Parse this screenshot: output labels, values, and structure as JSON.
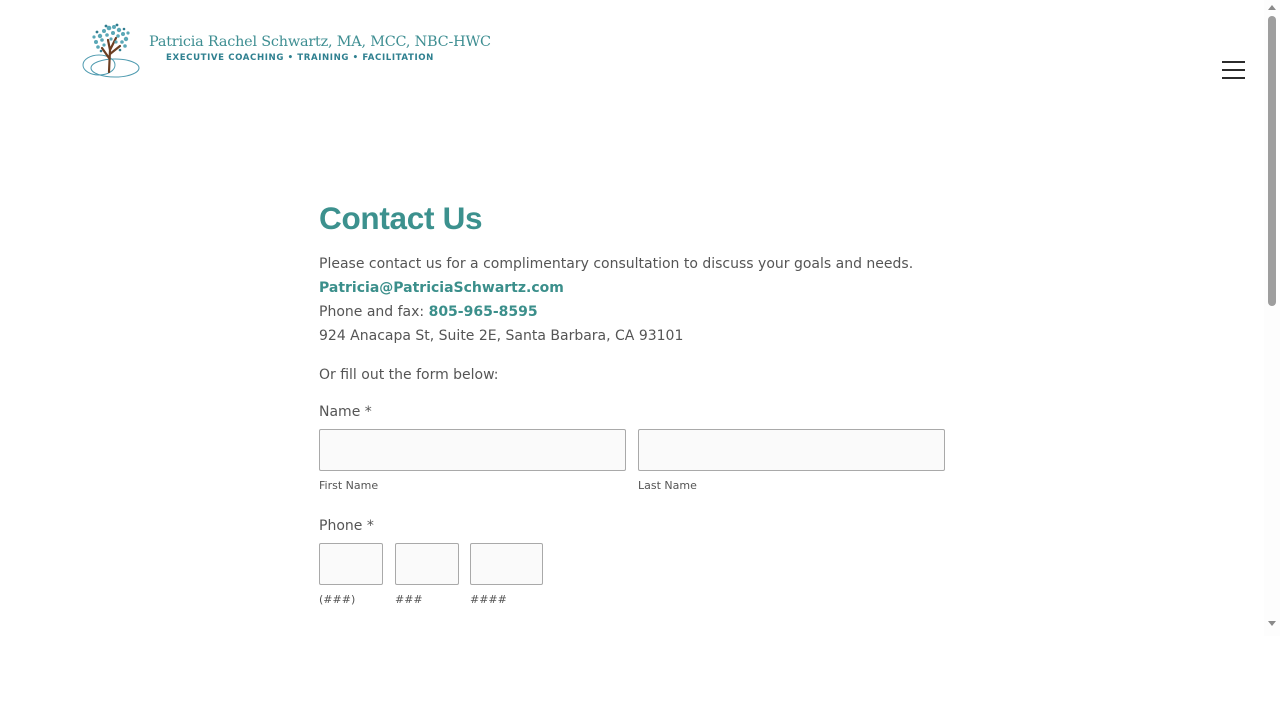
{
  "header": {
    "logo": {
      "name": "Patricia Rachel Schwartz, MA, MCC, NBC-HWC",
      "tagline": "EXECUTIVE COACHING  •  TRAINING  •  FACILITATION",
      "icon": "tree-logo-icon"
    },
    "menu_icon": "hamburger-menu-icon"
  },
  "main": {
    "title": "Contact Us",
    "intro": "Please contact us for a complimentary consultation to discuss your goals and needs.",
    "email": "Patricia@PatriciaSchwartz.com",
    "phone_prefix": "Phone and fax: ",
    "phone": "805-965-8595",
    "address": "924 Anacapa St, Suite 2E, Santa Barbara, CA 93101",
    "form_intro": "Or fill out the form below:"
  },
  "form": {
    "name": {
      "label": "Name *",
      "first": {
        "value": "",
        "sublabel": "First Name"
      },
      "last": {
        "value": "",
        "sublabel": "Last Name"
      }
    },
    "phone": {
      "label": "Phone *",
      "area": {
        "value": "",
        "sublabel": "(###)"
      },
      "prefix": {
        "value": "",
        "sublabel": "###"
      },
      "line": {
        "value": "",
        "sublabel": "####"
      }
    }
  },
  "colors": {
    "accent": "#3c918e",
    "text": "#555555",
    "input_border": "#a9a9a9"
  }
}
